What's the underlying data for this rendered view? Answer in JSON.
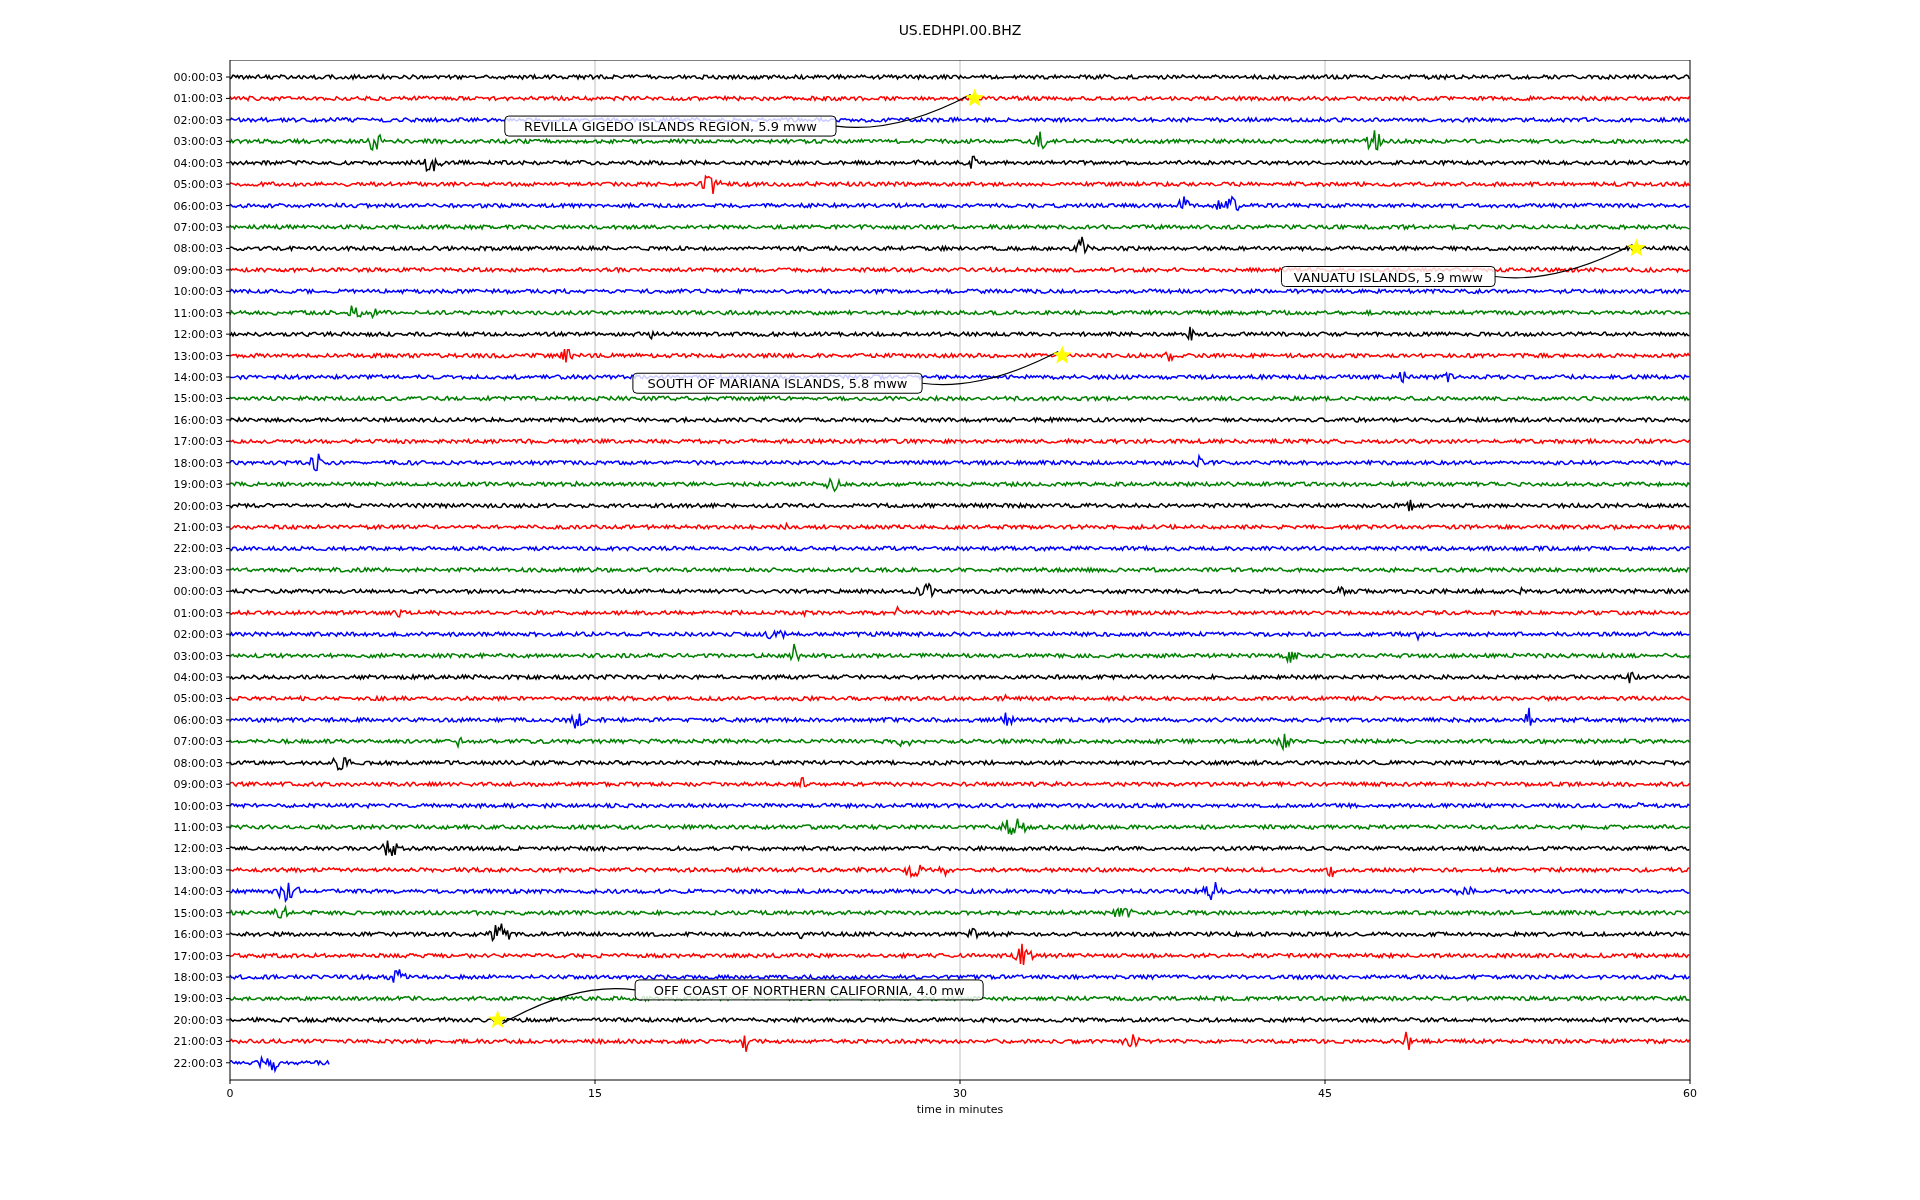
{
  "title": "US.EDHPI.00.BHZ",
  "chart": {
    "xlabel": "time in minutes",
    "xticks": [
      "0",
      "15",
      "30",
      "45",
      "60"
    ],
    "rows": [
      {
        "label": "00:00:03",
        "color": "#000000"
      },
      {
        "label": "01:00:03",
        "color": "#ff0000"
      },
      {
        "label": "02:00:03",
        "color": "#0000ff"
      },
      {
        "label": "03:00:03",
        "color": "#008000"
      },
      {
        "label": "04:00:03",
        "color": "#000000"
      },
      {
        "label": "05:00:03",
        "color": "#ff0000"
      },
      {
        "label": "06:00:03",
        "color": "#0000ff"
      },
      {
        "label": "07:00:03",
        "color": "#008000"
      },
      {
        "label": "08:00:03",
        "color": "#000000"
      },
      {
        "label": "09:00:03",
        "color": "#ff0000"
      },
      {
        "label": "10:00:03",
        "color": "#0000ff"
      },
      {
        "label": "11:00:03",
        "color": "#008000"
      },
      {
        "label": "12:00:03",
        "color": "#000000"
      },
      {
        "label": "13:00:03",
        "color": "#ff0000"
      },
      {
        "label": "14:00:03",
        "color": "#0000ff"
      },
      {
        "label": "15:00:03",
        "color": "#008000"
      },
      {
        "label": "16:00:03",
        "color": "#000000"
      },
      {
        "label": "17:00:03",
        "color": "#ff0000"
      },
      {
        "label": "18:00:03",
        "color": "#0000ff"
      },
      {
        "label": "19:00:03",
        "color": "#008000"
      },
      {
        "label": "20:00:03",
        "color": "#000000"
      },
      {
        "label": "21:00:03",
        "color": "#ff0000"
      },
      {
        "label": "22:00:03",
        "color": "#0000ff"
      },
      {
        "label": "23:00:03",
        "color": "#008000"
      },
      {
        "label": "00:00:03",
        "color": "#000000"
      },
      {
        "label": "01:00:03",
        "color": "#ff0000"
      },
      {
        "label": "02:00:03",
        "color": "#0000ff"
      },
      {
        "label": "03:00:03",
        "color": "#008000"
      },
      {
        "label": "04:00:03",
        "color": "#000000"
      },
      {
        "label": "05:00:03",
        "color": "#ff0000"
      },
      {
        "label": "06:00:03",
        "color": "#0000ff"
      },
      {
        "label": "07:00:03",
        "color": "#008000"
      },
      {
        "label": "08:00:03",
        "color": "#000000"
      },
      {
        "label": "09:00:03",
        "color": "#ff0000"
      },
      {
        "label": "10:00:03",
        "color": "#0000ff"
      },
      {
        "label": "11:00:03",
        "color": "#008000"
      },
      {
        "label": "12:00:03",
        "color": "#000000"
      },
      {
        "label": "13:00:03",
        "color": "#ff0000"
      },
      {
        "label": "14:00:03",
        "color": "#0000ff"
      },
      {
        "label": "15:00:03",
        "color": "#008000"
      },
      {
        "label": "16:00:03",
        "color": "#000000"
      },
      {
        "label": "17:00:03",
        "color": "#ff0000"
      },
      {
        "label": "18:00:03",
        "color": "#0000ff"
      },
      {
        "label": "19:00:03",
        "color": "#008000"
      },
      {
        "label": "20:00:03",
        "color": "#000000"
      },
      {
        "label": "21:00:03",
        "color": "#ff0000"
      },
      {
        "label": "22:00:03",
        "color": "#0000ff"
      }
    ],
    "annotations": [
      {
        "text": "REVILLA GIGEDO ISLANDS REGION, 5.9 mww"
      },
      {
        "text": "VANUATU ISLANDS, 5.9 mww"
      },
      {
        "text": "SOUTH OF MARIANA ISLANDS, 5.8 mww"
      },
      {
        "text": "OFF COAST OF NORTHERN CALIFORNIA, 4.0 mw"
      }
    ]
  }
}
